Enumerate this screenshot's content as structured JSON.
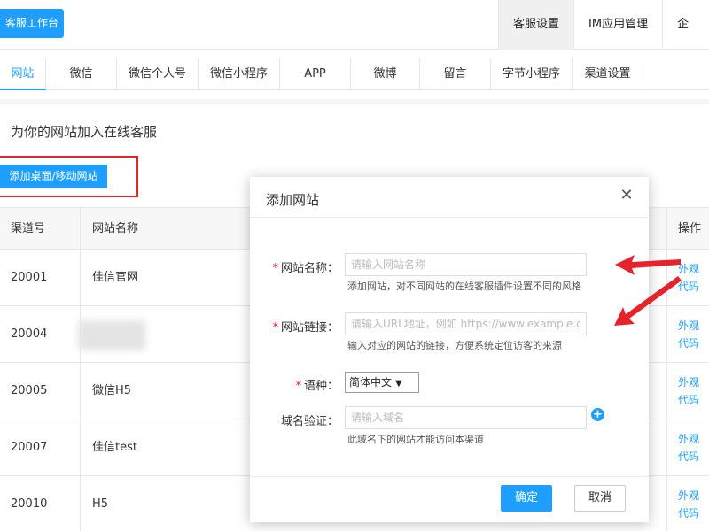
{
  "header": {
    "workbench_label": "客服工作台",
    "nav": [
      "客服设置",
      "IM应用管理",
      "企"
    ]
  },
  "tabs": [
    "网站",
    "微信",
    "微信个人号",
    "微信小程序",
    "APP",
    "微博",
    "留言",
    "字节小程序",
    "渠道设置"
  ],
  "page": {
    "title": "为你的网站加入在线客服",
    "add_button": "添加桌面/移动网站"
  },
  "table": {
    "headers": {
      "channel": "渠道号",
      "name": "网站名称",
      "ops": "操作"
    },
    "rows": [
      {
        "channel": "20001",
        "name": "佳信官网",
        "op1": "外观",
        "op2": "代码"
      },
      {
        "channel": "20004",
        "name": "",
        "op1": "外观",
        "op2": "代码"
      },
      {
        "channel": "20005",
        "name": "微信H5",
        "op1": "外观",
        "op2": "代码"
      },
      {
        "channel": "20007",
        "name": "佳信test",
        "op1": "外观",
        "op2": "代码"
      },
      {
        "channel": "20010",
        "name": "H5",
        "op1": "外观",
        "op2": "代码"
      }
    ]
  },
  "modal": {
    "title": "添加网站",
    "close_icon": "close-icon",
    "fields": {
      "name_label": "网站名称：",
      "name_placeholder": "请输入网站名称",
      "name_hint": "添加网站，对不同网站的在线客服插件设置不同的风格",
      "url_label": "网站链接：",
      "url_placeholder": "请输入URL地址，例如 https://www.example.com",
      "url_hint": "输入对应的网站的链接，方便系统定位访客的来源",
      "lang_label": "语种：",
      "lang_value": "简体中文",
      "domain_label": "域名验证：",
      "domain_placeholder": "请输入域名",
      "domain_hint": "此域名下的网站才能访问本渠道"
    },
    "ok_label": "确定",
    "cancel_label": "取消"
  },
  "colors": {
    "primary": "#1e9fff",
    "annotation": "#e5232b"
  }
}
